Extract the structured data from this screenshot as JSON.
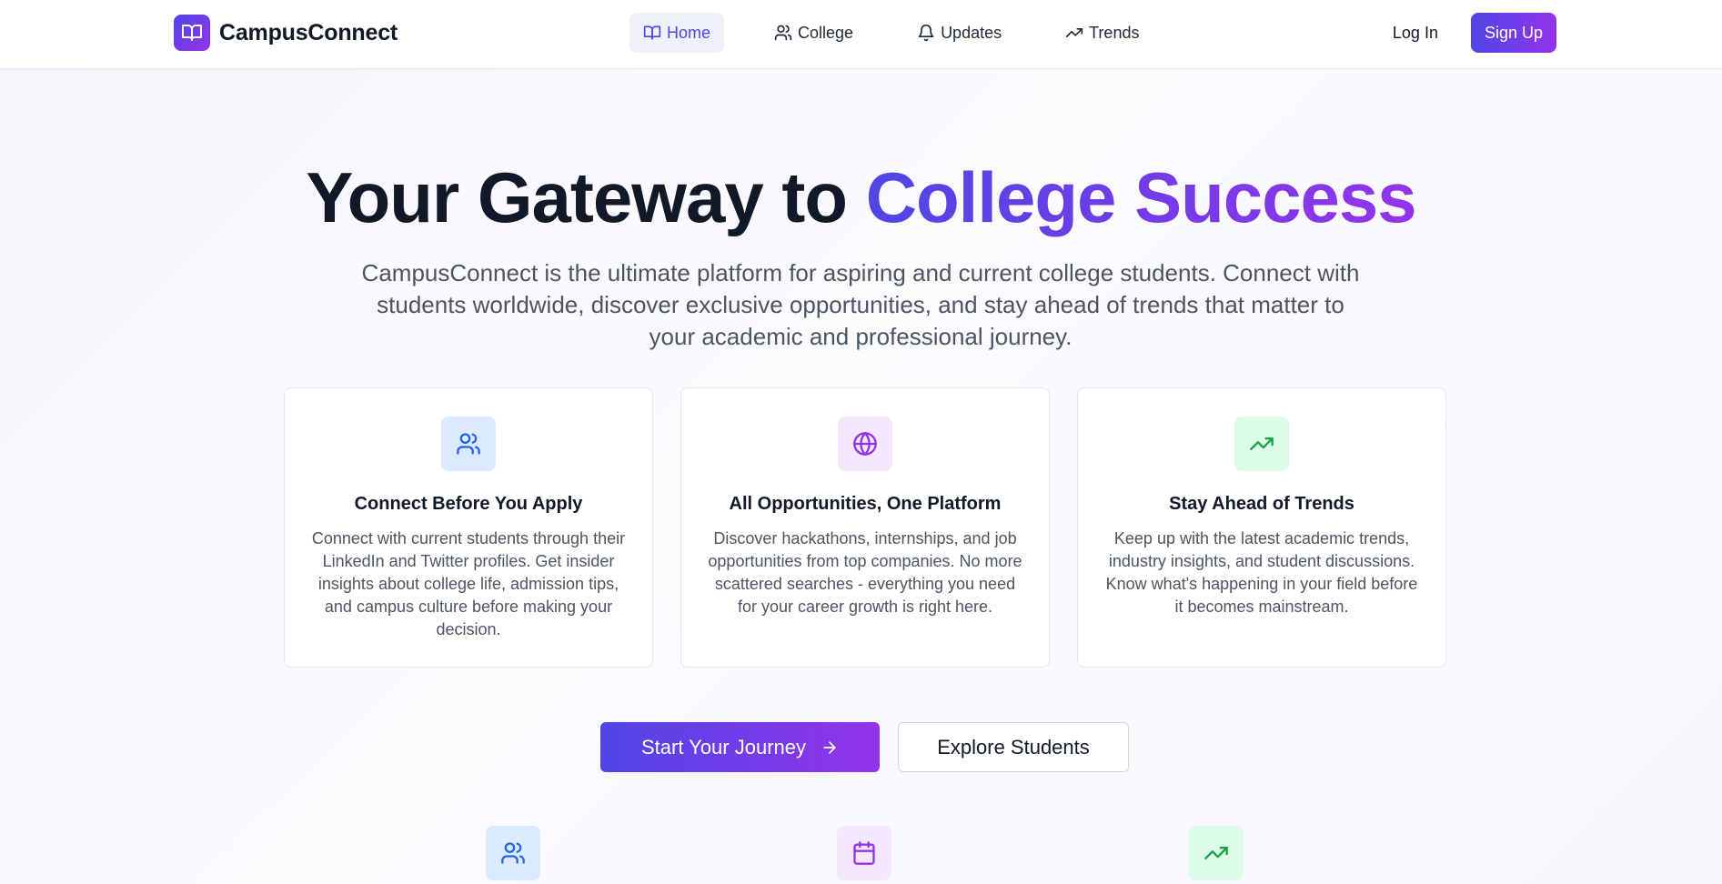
{
  "header": {
    "brand": "CampusConnect",
    "brand_icon": "book-open-icon",
    "nav": [
      {
        "label": "Home",
        "icon": "book-open-icon",
        "active": true
      },
      {
        "label": "College",
        "icon": "users-icon"
      },
      {
        "label": "Updates",
        "icon": "bell-icon"
      },
      {
        "label": "Trends",
        "icon": "trending-up-icon"
      }
    ],
    "login_label": "Log In",
    "signup_label": "Sign Up"
  },
  "hero": {
    "title_plain": "Your Gateway to ",
    "title_highlight": "College Success",
    "subtitle": "CampusConnect is the ultimate platform for aspiring and current college students. Connect with students worldwide, discover exclusive opportunities, and stay ahead of trends that matter to your academic and professional journey."
  },
  "features": [
    {
      "icon": "users-icon",
      "title": "Connect Before You Apply",
      "text": "Connect with current students through their LinkedIn and Twitter profiles. Get insider insights about college life, admission tips, and campus culture before making your decision."
    },
    {
      "icon": "globe-icon",
      "title": "All Opportunities, One Platform",
      "text": "Discover hackathons, internships, and job opportunities from top companies. No more scattered searches - everything you need for your career growth is right here."
    },
    {
      "icon": "trending-up-icon",
      "title": "Stay Ahead of Trends",
      "text": "Keep up with the latest academic trends, industry insights, and student discussions. Know what's happening in your field before it becomes mainstream."
    }
  ],
  "cta": {
    "primary_label": "Start Your Journey",
    "secondary_label": "Explore Students"
  },
  "stats_icons": [
    "users-icon",
    "calendar-icon",
    "trending-up-icon"
  ],
  "colors": {
    "accent_start": "#4f46e5",
    "accent_end": "#9333ea",
    "blue": "#2563eb",
    "purple": "#9333ea",
    "green": "#16a34a"
  }
}
